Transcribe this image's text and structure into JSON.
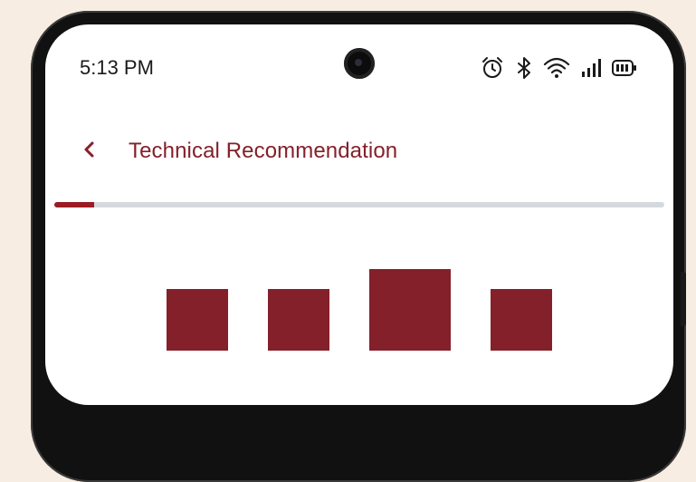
{
  "status_bar": {
    "time": "5:13 PM",
    "icons": [
      "alarm-icon",
      "bluetooth-icon",
      "wifi-icon",
      "signal-icon",
      "battery-icon"
    ]
  },
  "app_bar": {
    "back_icon": "chevron-left-icon",
    "title": "Technical Recommendation"
  },
  "progress": {
    "fraction": 0.065
  },
  "loader": {
    "blocks": 4,
    "active_index": 2
  },
  "colors": {
    "accent": "#84202a",
    "progress_fill": "#9b1c24",
    "progress_track": "#d5d9dd",
    "background": "#f8ede3"
  }
}
